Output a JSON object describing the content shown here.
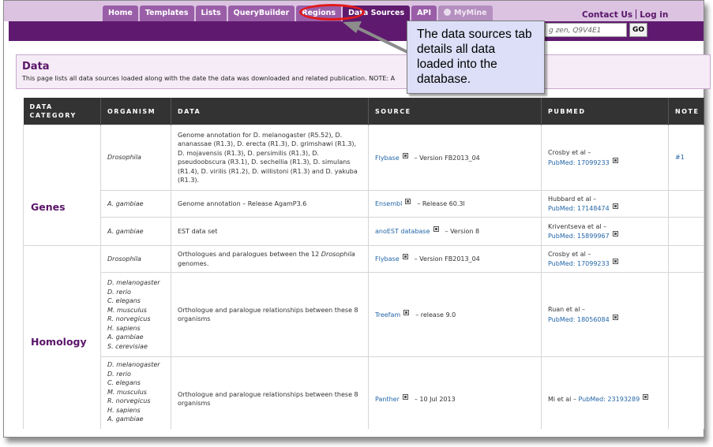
{
  "nav": {
    "tabs": [
      {
        "label": "Home"
      },
      {
        "label": "Templates"
      },
      {
        "label": "Lists"
      },
      {
        "label": "QueryBuilder"
      },
      {
        "label": "Regions"
      },
      {
        "label": "Data Sources"
      },
      {
        "label": "API"
      },
      {
        "label": "MyMine"
      }
    ],
    "contact_label": "Contact Us",
    "login_label": "Log in"
  },
  "search": {
    "value": "g zen, Q9V4E1",
    "go_label": "GO"
  },
  "page": {
    "title": "Data",
    "description": "This page lists all data sources loaded along with the date the data was downloaded and related publication. NOTE: A"
  },
  "callout": {
    "text": "The data sources tab details all data loaded into the database."
  },
  "table": {
    "headers": [
      "DATA CATEGORY",
      "ORGANISM",
      "DATA",
      "SOURCE",
      "PUBMED",
      "NOTE"
    ],
    "rows": [
      {
        "category": "Genes",
        "organism": "Drosophila",
        "data": "Genome annotation for D. melanogaster (R5.52), D. ananassae (R1.3), D. erecta (R1.3), D. grimshawi (R1.3), D. mojavensis (R1.3), D. persimilis (R1.3), D. pseudoobscura (R3.1), D. sechellia (R1.3), D. simulans (R1.4), D. virilis (R1.2), D. willistoni (R1.3) and D. yakuba (R1.3).",
        "source_link": "Flybase",
        "source_version": "– Version FB2013_04",
        "pub_authors": "Crosby et al –",
        "pub_link": "PubMed: 17099233",
        "note": "#1"
      },
      {
        "organism": "A. gambiae",
        "data": "Genome annotation – Release AgamP3.6",
        "source_link": "Ensembl",
        "source_version": "– Release 60.3l",
        "pub_authors": "Hubbard et al –",
        "pub_link": "PubMed: 17148474",
        "note": ""
      },
      {
        "organism": "A. gambiae",
        "data": "EST data set",
        "source_link": "anoEST database",
        "source_version": "– Version 8",
        "pub_authors": "Kriventseva et al –",
        "pub_link": "PubMed: 15899967",
        "note": ""
      },
      {
        "category": "Homology",
        "organism": "Drosophila",
        "data_pre": "Orthologues and paralogues between the 12",
        "data_italic": "Drosophila",
        "data_post": "genomes.",
        "source_link": "Flybase",
        "source_version": "– Version FB2013_04",
        "pub_authors": "Crosby et al –",
        "pub_link": "PubMed: 17099233",
        "note": ""
      },
      {
        "organisms": [
          "D. melanogaster",
          "D. rerio",
          "C. elegans",
          "M. musculus",
          "R. norvegicus",
          "H. sapiens",
          "A. gambiae",
          "S. cerevisiae"
        ],
        "data": "Orthologue and paralogue relationships between these 8 organisms",
        "source_link": "Treefam",
        "source_version": "– release 9.0",
        "pub_authors": "Ruan et al –",
        "pub_link": "PubMed: 18056084",
        "note": ""
      },
      {
        "organisms": [
          "D. melanogaster",
          "D. rerio",
          "C. elegans",
          "M. musculus",
          "R. norvegicus",
          "H. sapiens",
          "A. gambiae"
        ],
        "data": "Orthologue and paralogue relationships between these 8 organisms",
        "source_link": "Panther",
        "source_version": "– 10 Jul 2013",
        "pub_authors": "Mi et al –",
        "pub_link": "PubMed: 23193289",
        "note": ""
      }
    ]
  },
  "colors": {
    "nav_tab": "#9a5ea8",
    "nav_tab_active": "#5e1a6e",
    "purple_bar": "#5f1a6f",
    "category_text": "#5a1569",
    "link": "#2466a8",
    "highlight_ring": "#e21a1a",
    "callout_bg": "#dcdff7"
  },
  "icons": {
    "external_link": "external-link-icon",
    "user": "user-icon",
    "callout_pointer": "arrow-icon"
  }
}
